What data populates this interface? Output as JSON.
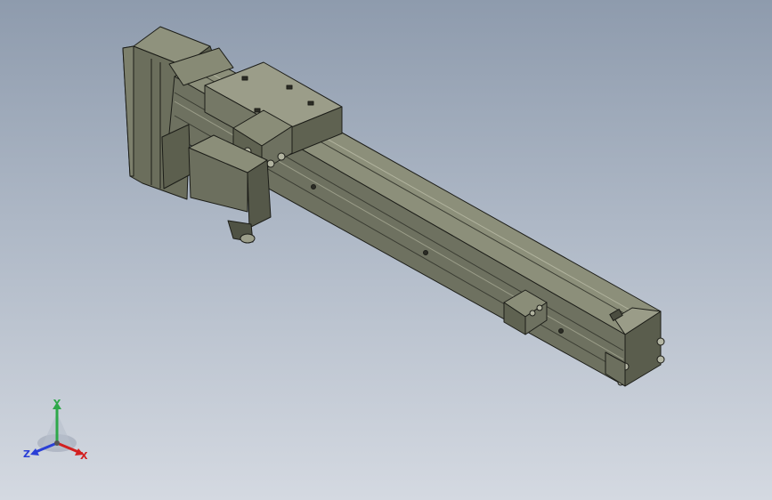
{
  "viewport": {
    "background_top": "#8e9bad",
    "background_bottom": "#d4d9e1"
  },
  "model": {
    "body_color": "#6f7261",
    "shadow_color": "#505347",
    "highlight_color": "#a7a994",
    "outline_color": "#1c1d18"
  },
  "triad": {
    "x_label": "X",
    "y_label": "Y",
    "z_label": "Z",
    "x_color": "#d22020",
    "y_color": "#2ea84a",
    "z_color": "#2a3fd6"
  }
}
